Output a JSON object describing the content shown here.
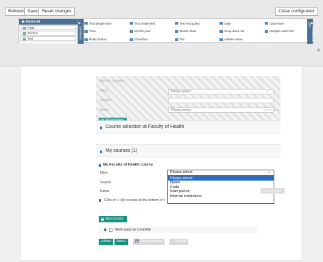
{
  "toolbar": {
    "refresh_label": "Refresh",
    "save_label": "Save",
    "reset_label": "Reset changes",
    "close_label": "Close configurator"
  },
  "general_panel": {
    "header": "▶ General",
    "items": [
      "Page",
      "Section",
      "Text"
    ]
  },
  "side_tabs": {
    "left": "▶ Questions",
    "right": "▶ Predefined (37)"
  },
  "question_types": [
    "Text (single line)",
    "Text (multi-line)",
    "Text encrypted",
    "Date",
    "Date+time",
    "Time",
    "Month+year",
    "Month+Date",
    "Drop-down list",
    "Multiple-select list",
    "Radio button",
    "Checkbox",
    "File",
    "Hidden value",
    ""
  ],
  "hatched": {
    "title": "My B.S courses",
    "filter_label": "Filter",
    "search_label": "Search",
    "name_label": "Name",
    "select_placeholder": "Please select",
    "select_placeholder2": "Please select",
    "confirm_label": "Confirm choice"
  },
  "buttons": {
    "my_courses": "My courses",
    "my_courses_2": "My courses",
    "confirm_choice": "Confirm choice",
    "back": "◂ Back",
    "next": "Next ▸",
    "save_progress": "💾 Save progress",
    "submit": "✓ Submit"
  },
  "sections": {
    "course_selection": "Course selection at Faculty of Health",
    "my_courses_count": "My courses (1)"
  },
  "faculty": {
    "header": "My Faculty of Health course",
    "filter_label": "Filter",
    "search_label": "Search",
    "name_label": "Name",
    "selected_value": "Please select",
    "options": [
      "Please select",
      "Name",
      "Code",
      "Start period",
      "Internal institutions"
    ]
  },
  "note": "Click on + My courses at the bottom of the page",
  "checkbox_label": "Mark page as complete",
  "colors": {
    "accent": "#17927f",
    "blue": "#4a6f93",
    "selected": "#1e6fd9"
  }
}
